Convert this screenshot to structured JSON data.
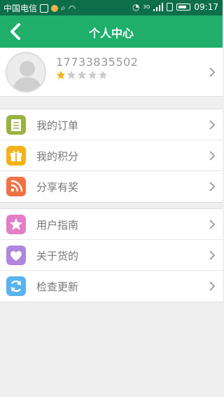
{
  "status_bar": {
    "carrier": "中国电信",
    "time": "09:17",
    "network_label": "3G"
  },
  "header": {
    "title": "个人中心"
  },
  "profile": {
    "phone": "17733835502",
    "rating": 1,
    "rating_max": 5
  },
  "menu_group_1": [
    {
      "label": "我的订单",
      "icon": "notepad-icon",
      "color": "#9ab23f"
    },
    {
      "label": "我的积分",
      "icon": "gift-icon",
      "color": "#f3b21c"
    },
    {
      "label": "分享有奖",
      "icon": "rss-icon",
      "color": "#f07245"
    }
  ],
  "menu_group_2": [
    {
      "label": "用户指南",
      "icon": "star-icon",
      "color": "#e37fc6"
    },
    {
      "label": "关于货的",
      "icon": "heart-icon",
      "color": "#b087dd"
    },
    {
      "label": "检查更新",
      "icon": "refresh-icon",
      "color": "#5ab3ee"
    }
  ],
  "colors": {
    "header_bg": "#1faf6b",
    "status_bg": "#0d6f4a",
    "star_filled": "#f3b21c",
    "star_empty": "#cccccc"
  }
}
